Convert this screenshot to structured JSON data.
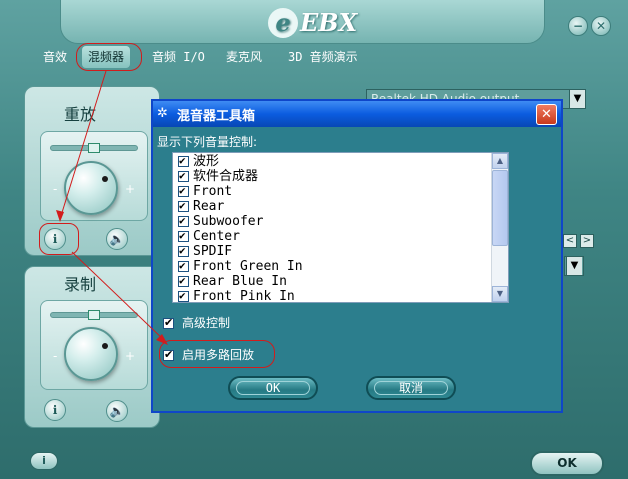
{
  "app": {
    "logo_text": "EBX",
    "logo_letter": "e",
    "minimize_glyph": "−",
    "close_glyph": "✕",
    "ok_label": "OK",
    "info_glyph": "i"
  },
  "tabs": [
    {
      "label": "音效",
      "active": false
    },
    {
      "label": "混频器",
      "active": true
    },
    {
      "label": "音频 I/O",
      "active": false
    },
    {
      "label": "麦克风",
      "active": false
    },
    {
      "label": "3D 音频演示",
      "active": false
    }
  ],
  "playback": {
    "title": "重放",
    "minus": "-",
    "plus": "+",
    "tools_glyph": "ℹ",
    "speaker_glyph": "🔈"
  },
  "record": {
    "title": "录制",
    "minus": "-",
    "plus": "+",
    "tools_glyph": "ℹ",
    "speaker_glyph": "🔈"
  },
  "background": {
    "device_field": "Realtek HD Audio output",
    "drop_glyph": "▼",
    "nav_prev": "<",
    "nav_next": ">"
  },
  "dialog": {
    "title_icon": "✲",
    "title": "混音器工具箱",
    "close_glyph": "✕",
    "list_label": "显示下列音量控制:",
    "items": [
      {
        "label": "波形",
        "checked": true
      },
      {
        "label": "软件合成器",
        "checked": true
      },
      {
        "label": "Front",
        "checked": true
      },
      {
        "label": "Rear",
        "checked": true
      },
      {
        "label": "Subwoofer",
        "checked": true
      },
      {
        "label": "Center",
        "checked": true
      },
      {
        "label": "SPDIF",
        "checked": true
      },
      {
        "label": "Front Green In",
        "checked": true
      },
      {
        "label": "Rear Blue In",
        "checked": true
      },
      {
        "label": "Front Pink In",
        "checked": true
      }
    ],
    "scroll_up": "▲",
    "scroll_down": "▼",
    "advanced_label": "高级控制",
    "advanced_checked": true,
    "multi_label": "启用多路回放",
    "multi_checked": true,
    "ok_label": "OK",
    "cancel_label": "取消"
  },
  "colors": {
    "annotation": "#d21c1c",
    "titlebar": "#0b5ce0",
    "dialog_bg": "#2c7e8d"
  }
}
